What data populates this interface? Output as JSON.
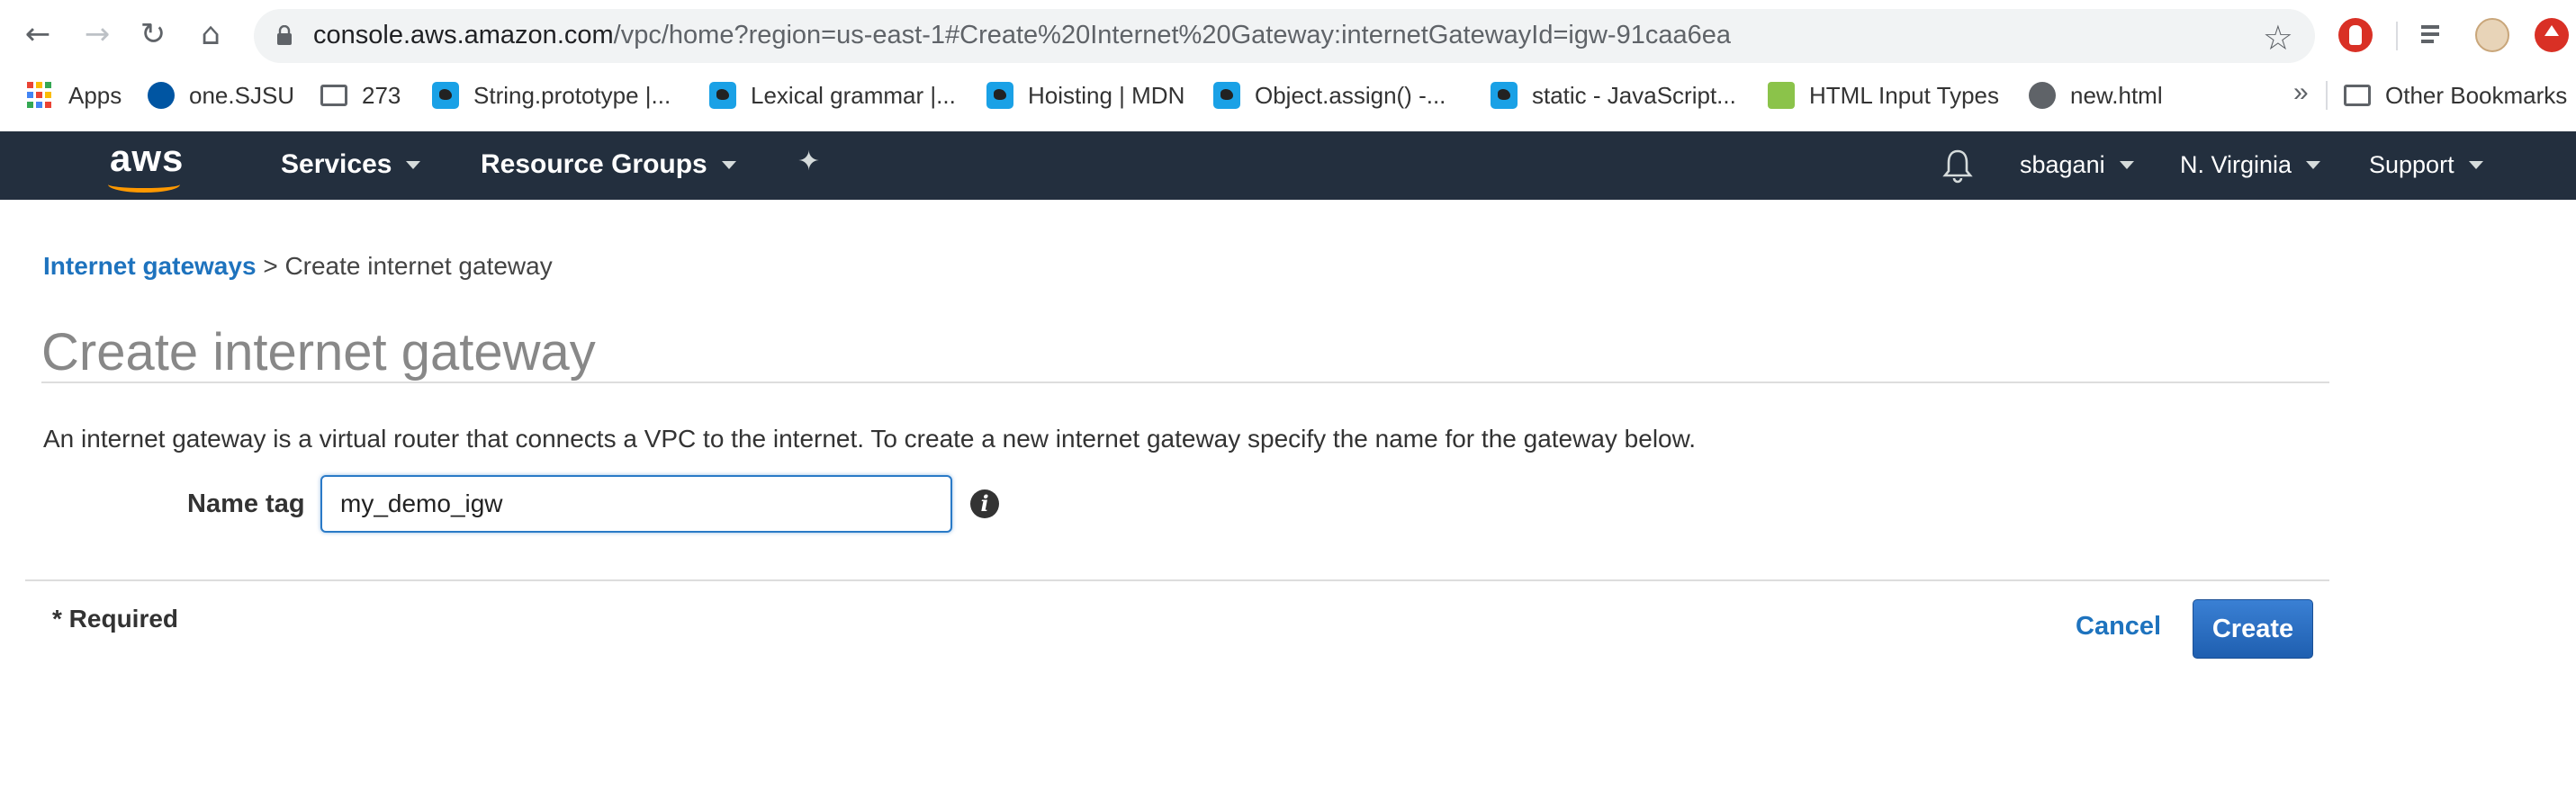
{
  "browser": {
    "url_host": "console.aws.amazon.com",
    "url_path": "/vpc/home?region=us-east-1#Create%20Internet%20Gateway:internetGatewayId=igw-91caa6ea",
    "icons": [
      "back-icon",
      "forward-icon",
      "reload-icon",
      "home-icon",
      "lock-icon",
      "star-icon"
    ],
    "bookmarks": [
      {
        "label": "Apps",
        "icon": "apps-grid-icon"
      },
      {
        "label": "one.SJSU",
        "icon": "sjsu-icon"
      },
      {
        "label": "273",
        "icon": "folder-icon"
      },
      {
        "label": "String.prototype |...",
        "icon": "mdn-icon"
      },
      {
        "label": "Lexical grammar |...",
        "icon": "mdn-icon"
      },
      {
        "label": "Hoisting | MDN",
        "icon": "mdn-icon"
      },
      {
        "label": "Object.assign() -...",
        "icon": "mdn-icon"
      },
      {
        "label": "static - JavaScript...",
        "icon": "mdn-icon"
      },
      {
        "label": "HTML Input Types",
        "icon": "w3-icon"
      },
      {
        "label": "new.html",
        "icon": "globe-icon"
      }
    ],
    "bookmarks_more": "»",
    "other_bookmarks": "Other Bookmarks"
  },
  "aws_nav": {
    "logo": "aws",
    "services": "Services",
    "resource_groups": "Resource Groups",
    "user": "sbagani",
    "region": "N. Virginia",
    "support": "Support",
    "colors": {
      "bar": "#232f3e",
      "logo_smile": "#ff9900"
    }
  },
  "page": {
    "breadcrumb_link": "Internet gateways",
    "breadcrumb_current": "> Create internet gateway",
    "title": "Create internet gateway",
    "description": "An internet gateway is a virtual router that connects a VPC to the internet. To create a new internet gateway specify the name for the gateway below.",
    "name_tag_label": "Name tag",
    "name_tag_value": "my_demo_igw",
    "required_note": "* Required",
    "cancel_label": "Cancel",
    "create_label": "Create",
    "colors": {
      "link": "#1e73be",
      "primary_button": "#2a6fc9"
    }
  }
}
